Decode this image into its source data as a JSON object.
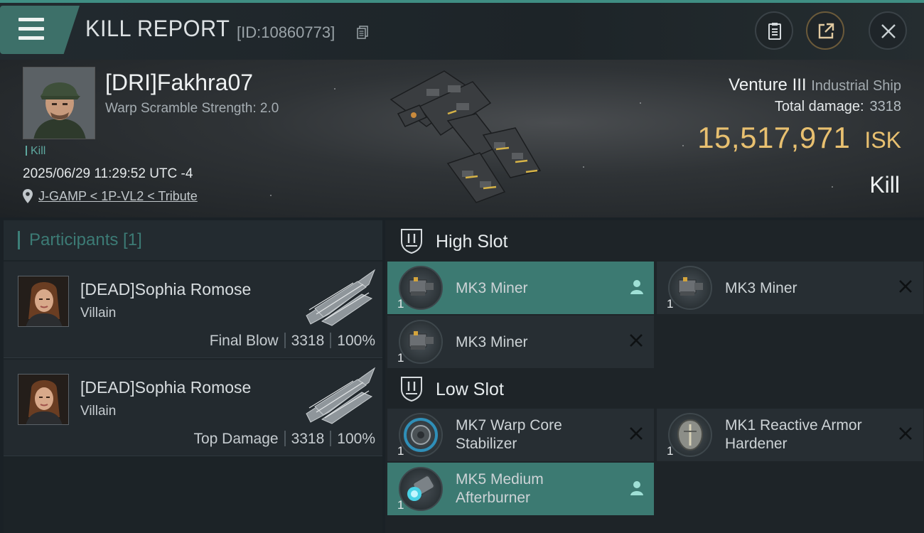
{
  "header": {
    "title": "KILL REPORT",
    "report_id": "[ID:10860773]"
  },
  "victim": {
    "name": "[DRI]Fakhra07",
    "warp_scramble": "Warp Scramble Strength: 2.0",
    "tag": "Kill",
    "timestamp": "2025/06/29 11:29:52 UTC -4",
    "location": "J-GAMP < 1P-VL2 < Tribute",
    "ship_name": "Venture III",
    "ship_class": "Industrial Ship",
    "total_damage_label": "Total damage:",
    "total_damage": "3318",
    "isk_value": "15,517,971",
    "isk_unit": "ISK",
    "result": "Kill"
  },
  "participants": {
    "title": "Participants [1]",
    "rows": [
      {
        "name": "[DEAD]Sophia Romose",
        "role": "Villain",
        "label": "Final Blow",
        "damage": "3318",
        "percent": "100%"
      },
      {
        "name": "[DEAD]Sophia Romose",
        "role": "Villain",
        "label": "Top Damage",
        "damage": "3318",
        "percent": "100%"
      }
    ]
  },
  "fittings": {
    "high_slot": {
      "title": "High Slot",
      "modules": [
        {
          "name": "MK3 Miner",
          "qty": "1",
          "status": "pilot-icon",
          "active": true
        },
        {
          "name": "MK3 Miner",
          "qty": "1",
          "status": "destroyed-icon",
          "active": false
        },
        {
          "name": "MK3 Miner",
          "qty": "1",
          "status": "destroyed-icon",
          "active": false
        }
      ]
    },
    "low_slot": {
      "title": "Low Slot",
      "modules": [
        {
          "name_line1": "MK7 Warp Core",
          "name_line2": "Stabilizer",
          "qty": "1",
          "status": "destroyed-icon",
          "active": false
        },
        {
          "name_line1": "MK1 Reactive Armor",
          "name_line2": "Hardener",
          "qty": "1",
          "status": "destroyed-icon",
          "active": false
        },
        {
          "name_line1": "MK5 Medium",
          "name_line2": "Afterburner",
          "qty": "1",
          "status": "pilot-icon",
          "active": true
        }
      ]
    }
  },
  "colors": {
    "accent": "#3c7a72",
    "isk": "#e8c070",
    "participants_title": "#3c7b75"
  }
}
